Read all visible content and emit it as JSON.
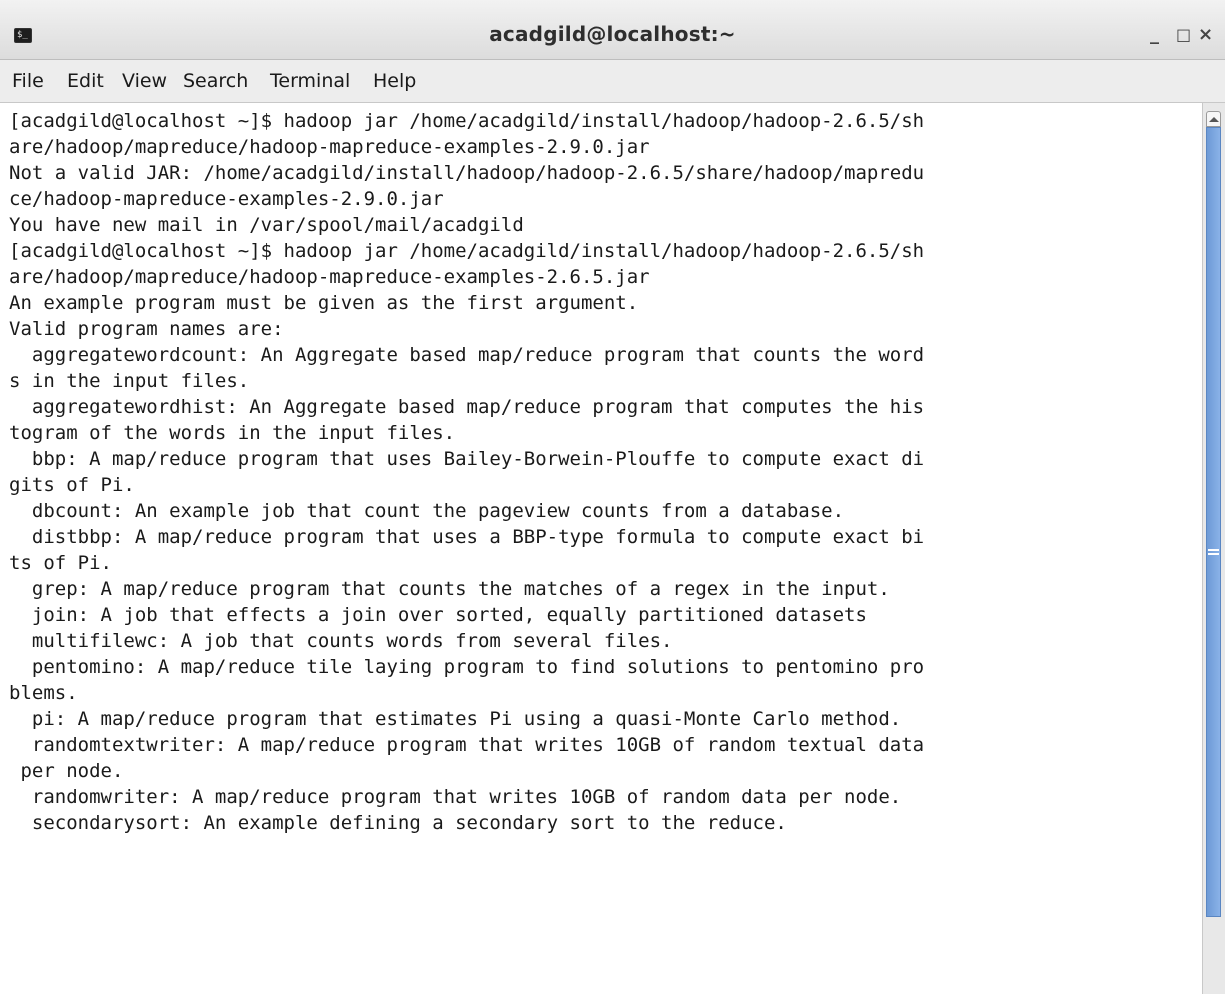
{
  "window": {
    "title": "acadgild@localhost:~",
    "icon": "terminal-icon",
    "icon_glyph": "$_",
    "controls": {
      "minimize": "_",
      "maximize": "□",
      "close": "×"
    }
  },
  "menu": {
    "file": "File",
    "edit": "Edit",
    "view": "View",
    "search": "Search",
    "terminal": "Terminal",
    "help": "Help"
  },
  "terminal": {
    "lines": [
      "[acadgild@localhost ~]$ hadoop jar /home/acadgild/install/hadoop/hadoop-2.6.5/sh",
      "are/hadoop/mapreduce/hadoop-mapreduce-examples-2.9.0.jar",
      "Not a valid JAR: /home/acadgild/install/hadoop/hadoop-2.6.5/share/hadoop/mapredu",
      "ce/hadoop-mapreduce-examples-2.9.0.jar",
      "You have new mail in /var/spool/mail/acadgild",
      "[acadgild@localhost ~]$ hadoop jar /home/acadgild/install/hadoop/hadoop-2.6.5/sh",
      "are/hadoop/mapreduce/hadoop-mapreduce-examples-2.6.5.jar",
      "An example program must be given as the first argument.",
      "Valid program names are:",
      "  aggregatewordcount: An Aggregate based map/reduce program that counts the word",
      "s in the input files.",
      "  aggregatewordhist: An Aggregate based map/reduce program that computes the his",
      "togram of the words in the input files.",
      "  bbp: A map/reduce program that uses Bailey-Borwein-Plouffe to compute exact di",
      "gits of Pi.",
      "  dbcount: An example job that count the pageview counts from a database.",
      "  distbbp: A map/reduce program that uses a BBP-type formula to compute exact bi",
      "ts of Pi.",
      "  grep: A map/reduce program that counts the matches of a regex in the input.",
      "  join: A job that effects a join over sorted, equally partitioned datasets",
      "  multifilewc: A job that counts words from several files.",
      "  pentomino: A map/reduce tile laying program to find solutions to pentomino pro",
      "blems.",
      "  pi: A map/reduce program that estimates Pi using a quasi-Monte Carlo method.",
      "  randomtextwriter: A map/reduce program that writes 10GB of random textual data",
      " per node.",
      "  randomwriter: A map/reduce program that writes 10GB of random data per node.",
      "  secondarysort: An example defining a secondary sort to the reduce."
    ]
  },
  "scrollbar": {
    "position_fraction": 0.97
  }
}
